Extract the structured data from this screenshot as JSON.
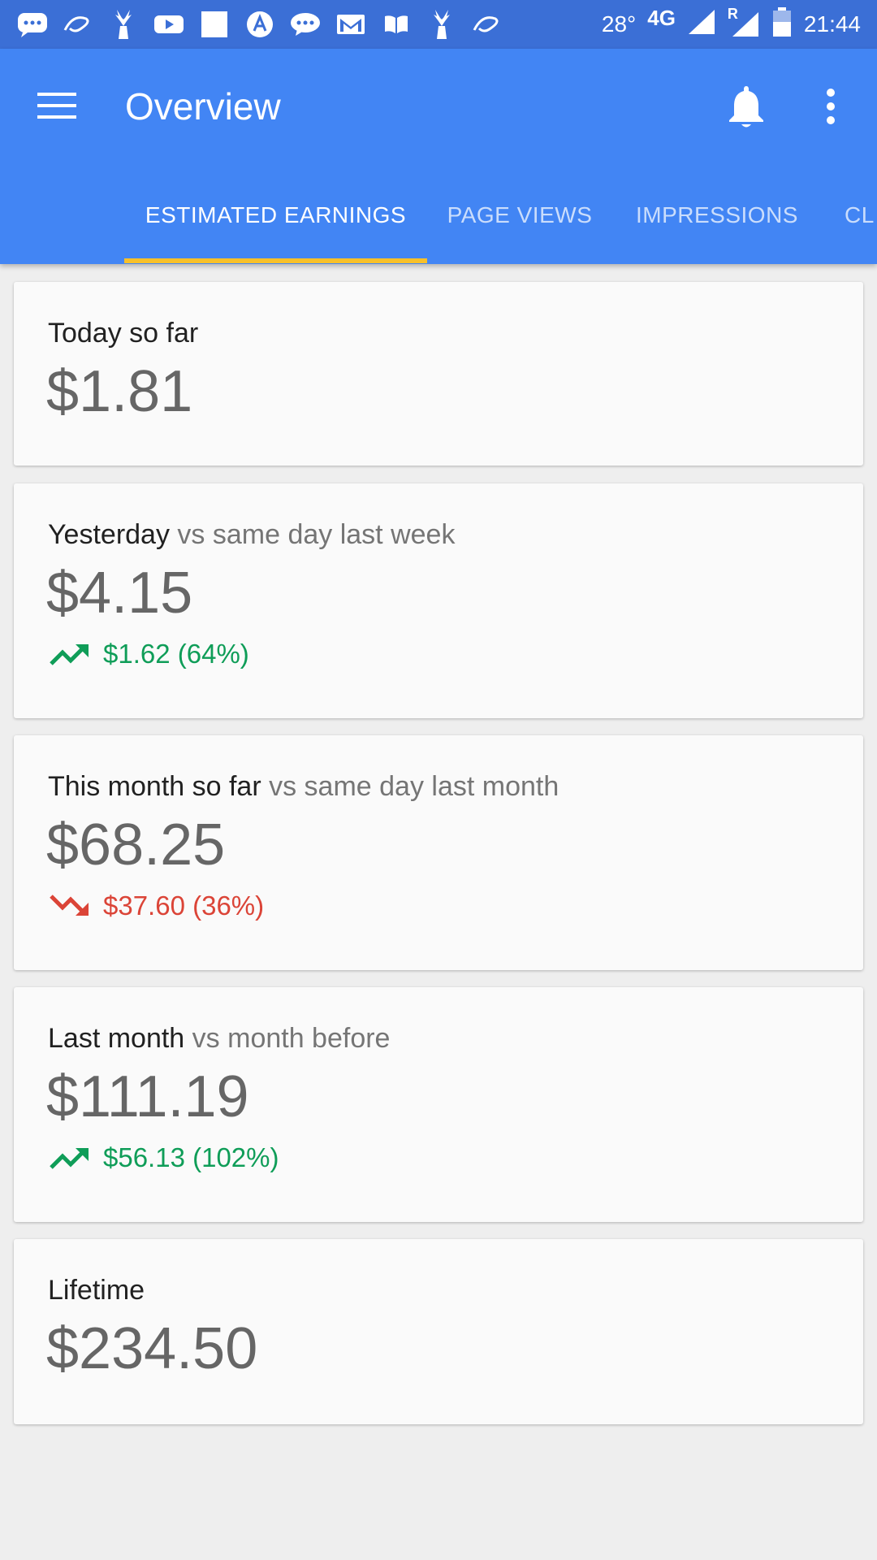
{
  "status_bar": {
    "temperature": "28°",
    "network": "4G",
    "roaming": "R",
    "time": "21:44"
  },
  "app_bar": {
    "title": "Overview",
    "tabs": [
      {
        "label": "ESTIMATED EARNINGS",
        "active": true
      },
      {
        "label": "PAGE VIEWS",
        "active": false
      },
      {
        "label": "IMPRESSIONS",
        "active": false
      },
      {
        "label": "CL",
        "active": false
      }
    ]
  },
  "colors": {
    "app_bar": "#4285f4",
    "status_bar": "#3b6fd6",
    "tab_indicator": "#f7c02a",
    "positive": "#0f9d58",
    "negative": "#db4437"
  },
  "cards": [
    {
      "label": "Today so far",
      "compare": "",
      "value": "$1.81"
    },
    {
      "label": "Yesterday",
      "compare": "vs same day last week",
      "value": "$4.15",
      "change": "$1.62 (64%)",
      "trend": "up"
    },
    {
      "label": "This month so far",
      "compare": "vs same day last month",
      "value": "$68.25",
      "change": "$37.60 (36%)",
      "trend": "down"
    },
    {
      "label": "Last month",
      "compare": "vs month before",
      "value": "$111.19",
      "change": "$56.13 (102%)",
      "trend": "up"
    },
    {
      "label": "Lifetime",
      "compare": "",
      "value": "$234.50"
    }
  ]
}
